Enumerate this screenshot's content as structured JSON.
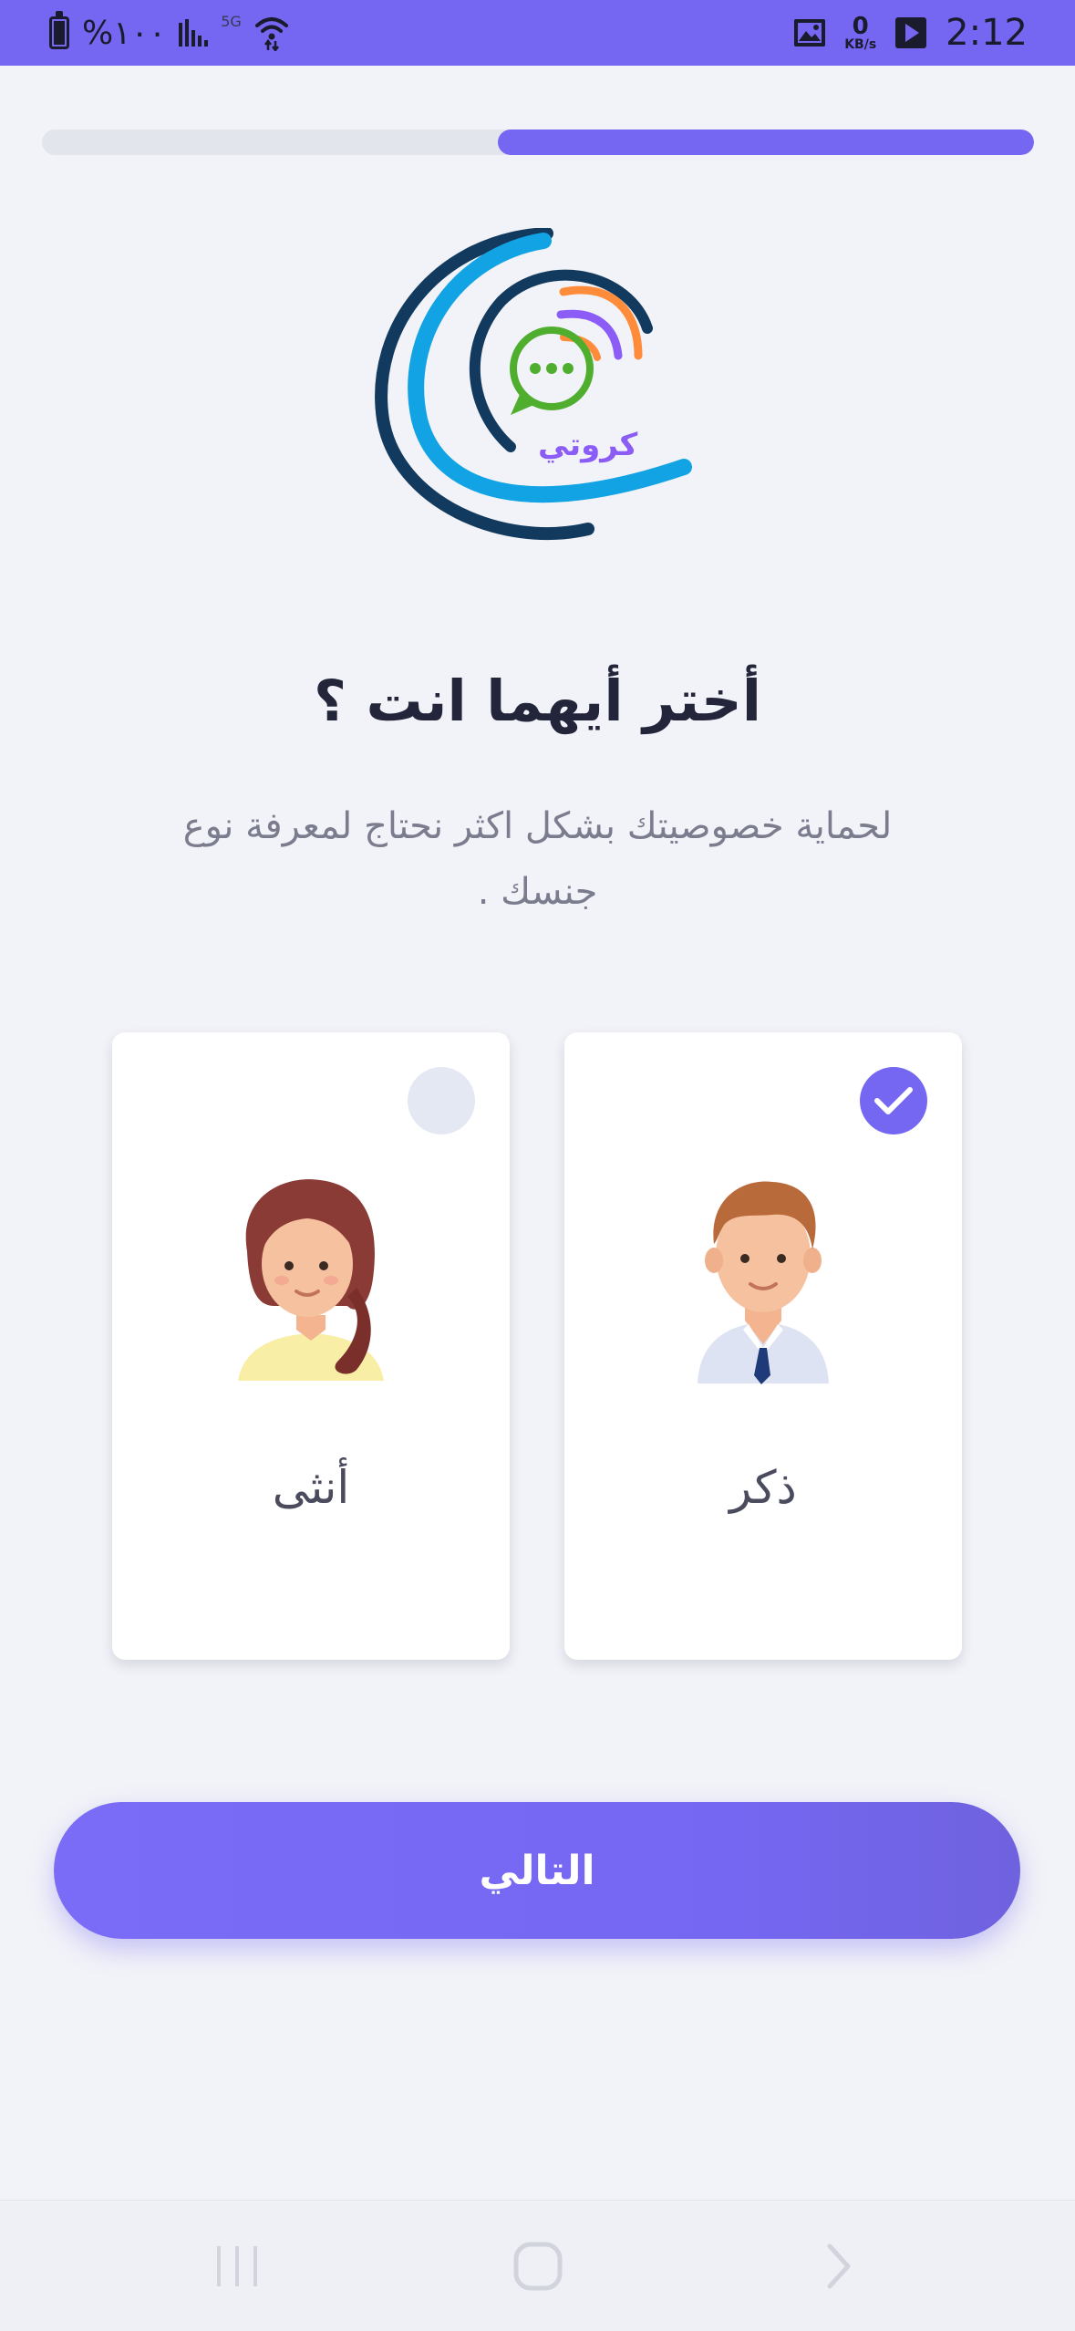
{
  "status_bar": {
    "battery": "%١٠٠",
    "network": "5G",
    "speed_value": "0",
    "speed_unit": "KB/s",
    "time": "2:12",
    "icons": [
      "battery-icon",
      "signal-icon",
      "wifi-icon",
      "image-icon",
      "play-store-icon"
    ]
  },
  "progress": {
    "value": 0.54
  },
  "logo": {
    "text": "كروتي"
  },
  "title": "أختر أيهما انت ؟",
  "subtitle": "لحماية خصوصيتك بشكل اكثر نحتاج لمعرفة نوع جنسك .",
  "options": {
    "male": {
      "label": "ذكر",
      "selected": true
    },
    "female": {
      "label": "أنثى",
      "selected": false
    }
  },
  "next_button": {
    "label": "التالي"
  },
  "nav_bar": {
    "icons": [
      "recents-icon",
      "home-icon",
      "back-icon"
    ]
  },
  "colors": {
    "accent": "#7667f2",
    "background": "#f2f3f8",
    "title": "#23253a",
    "subtitle": "#7b7d8f"
  }
}
